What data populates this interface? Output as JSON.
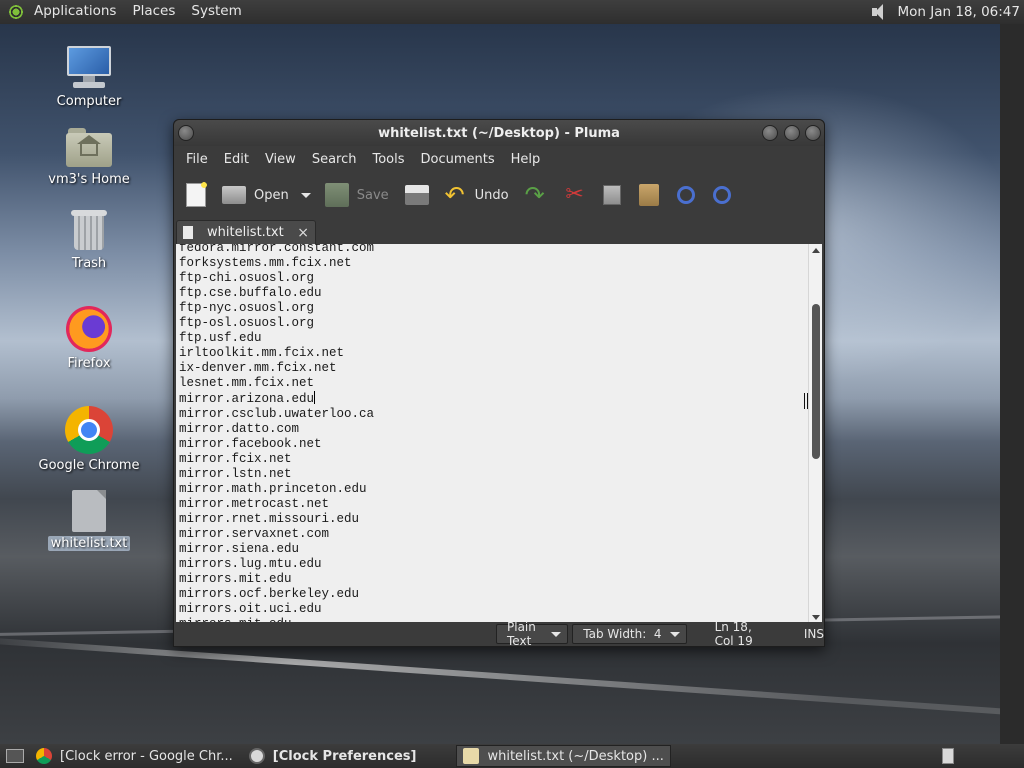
{
  "top_panel": {
    "menus": [
      "Applications",
      "Places",
      "System"
    ],
    "clock": "Mon Jan 18, 06:47"
  },
  "desktop_icons": [
    {
      "label": "Computer",
      "icon": "computer-icon"
    },
    {
      "label": "vm3's Home",
      "icon": "home-folder-icon"
    },
    {
      "label": "Trash",
      "icon": "trash-icon"
    },
    {
      "label": "Firefox",
      "icon": "firefox-icon"
    },
    {
      "label": "Google Chrome",
      "icon": "chrome-icon"
    },
    {
      "label": "whitelist.txt",
      "icon": "text-file-icon",
      "selected": true
    }
  ],
  "window": {
    "title": "whitelist.txt (~/Desktop) - Pluma",
    "menu": [
      "File",
      "Edit",
      "View",
      "Search",
      "Tools",
      "Documents",
      "Help"
    ],
    "toolbar": {
      "open_label": "Open",
      "save_label": "Save",
      "undo_label": "Undo"
    },
    "tab": {
      "label": "whitelist.txt",
      "close": "×"
    },
    "lines": [
      "fedora.mirror.constant.com",
      "forksystems.mm.fcix.net",
      "ftp-chi.osuosl.org",
      "ftp.cse.buffalo.edu",
      "ftp-nyc.osuosl.org",
      "ftp-osl.osuosl.org",
      "ftp.usf.edu",
      "irltoolkit.mm.fcix.net",
      "ix-denver.mm.fcix.net",
      "lesnet.mm.fcix.net",
      "mirror.arizona.edu",
      "mirror.csclub.uwaterloo.ca",
      "mirror.datto.com",
      "mirror.facebook.net",
      "mirror.fcix.net",
      "mirror.lstn.net",
      "mirror.math.princeton.edu",
      "mirror.metrocast.net",
      "mirror.rnet.missouri.edu",
      "mirror.servaxnet.com",
      "mirror.siena.edu",
      "mirrors.lug.mtu.edu",
      "mirrors.mit.edu",
      "mirrors.ocf.berkeley.edu",
      "mirrors.oit.uci.edu",
      "mirrors.mit.edu"
    ],
    "cursor_line_index": 10,
    "status": {
      "language": "Plain Text",
      "tab_width": "Tab Width:  4",
      "position": "Ln 18, Col 19",
      "mode": "INS"
    }
  },
  "taskbar": {
    "tasks": [
      {
        "label": "[Clock error - Google Chr...",
        "icon": "chrome-icon"
      },
      {
        "label": "[Clock Preferences]",
        "icon": "clock-icon"
      },
      {
        "label": "whitelist.txt (~/Desktop) ...",
        "icon": "pluma-icon"
      }
    ]
  }
}
